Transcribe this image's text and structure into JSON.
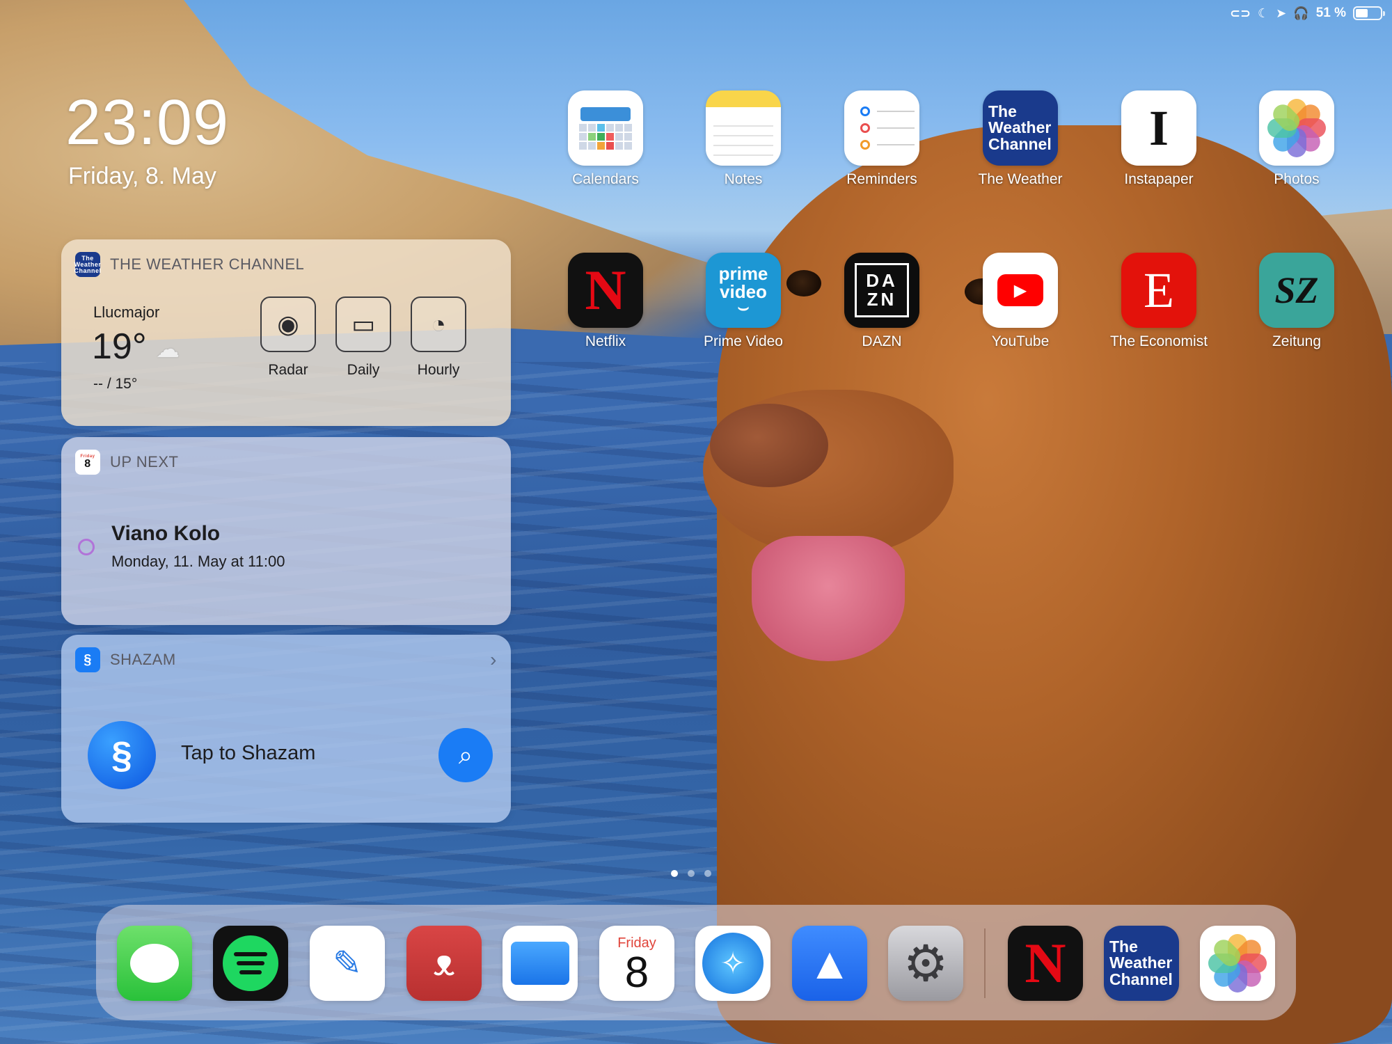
{
  "status_bar": {
    "battery_text": "51 %",
    "battery_level": 0.51,
    "icons": [
      "link-icon",
      "moon-icon",
      "location-arrow-icon",
      "headphones-icon",
      "battery-icon"
    ]
  },
  "lock": {
    "time": "23:09",
    "date": "Friday, 8. May"
  },
  "widgets": {
    "weather": {
      "header": "THE WEATHER CHANNEL",
      "badge": "The Weather Channel",
      "city": "Llucmajor",
      "temp": "19°",
      "condition_icon": "moon-cloud-icon",
      "range": "-- / 15°",
      "buttons": [
        {
          "label": "Radar",
          "icon": "radar-icon"
        },
        {
          "label": "Daily",
          "icon": "calendar-icon"
        },
        {
          "label": "Hourly",
          "icon": "clock-icon"
        }
      ]
    },
    "upnext": {
      "header": "UP NEXT",
      "badge_day": "Friday",
      "badge_num": "8",
      "event_title": "Viano Kolo",
      "event_time": "Monday, 11. May at 11:00"
    },
    "shazam": {
      "header": "SHAZAM",
      "action": "Tap to Shazam"
    }
  },
  "apps_row1": [
    {
      "label": "Calendars"
    },
    {
      "label": "Notes"
    },
    {
      "label": "Reminders"
    },
    {
      "label": "The Weather",
      "icon_text": "The Weather Channel"
    },
    {
      "label": "Instapaper",
      "icon_text": "I"
    },
    {
      "label": "Photos"
    }
  ],
  "apps_row2": [
    {
      "label": "Netflix",
      "icon_text": "N"
    },
    {
      "label": "Prime Video",
      "icon_text_1": "prime",
      "icon_text_2": "video"
    },
    {
      "label": "DAZN",
      "icon_text": "DA ZN"
    },
    {
      "label": "YouTube"
    },
    {
      "label": "The Economist",
      "icon_text": "E"
    },
    {
      "label": "Zeitung",
      "icon_text": "SZ"
    }
  ],
  "page_dots": {
    "count": 3,
    "active": 1
  },
  "dock": {
    "apps": [
      "Messages",
      "Spotify",
      "Editorial",
      "Bear",
      "Files",
      "Calendar",
      "Safari",
      "Spark",
      "Settings"
    ],
    "recent": [
      "Netflix",
      "The Weather Channel",
      "Photos"
    ],
    "calendar_day": "Friday",
    "calendar_num": "8",
    "netflix_text": "N",
    "twc_text": "The Weather Channel"
  },
  "colors": {
    "twc_blue": "#1a3a8c",
    "netflix_red": "#e50914",
    "shazam_blue": "#1a7cf5",
    "economist_red": "#e3120b"
  }
}
